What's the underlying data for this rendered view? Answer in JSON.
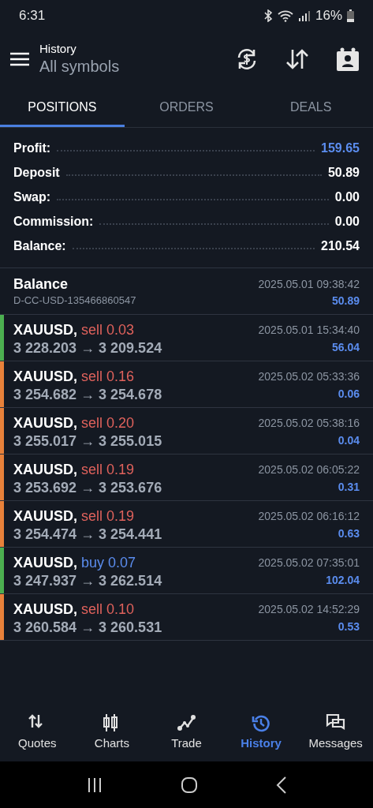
{
  "status_bar": {
    "time": "6:31",
    "battery": "16%"
  },
  "header": {
    "title": "History",
    "subtitle": "All symbols"
  },
  "tabs": [
    {
      "label": "POSITIONS",
      "selected": true
    },
    {
      "label": "ORDERS",
      "selected": false
    },
    {
      "label": "DEALS",
      "selected": false
    }
  ],
  "summary": [
    {
      "label": "Profit:",
      "value": "159.65",
      "highlight": true
    },
    {
      "label": "Deposit",
      "value": "50.89",
      "highlight": false
    },
    {
      "label": "Swap:",
      "value": "0.00",
      "highlight": false
    },
    {
      "label": "Commission:",
      "value": "0.00",
      "highlight": false
    },
    {
      "label": "Balance:",
      "value": "210.54",
      "highlight": false
    }
  ],
  "balance_entry": {
    "title": "Balance",
    "account": "D-CC-USD-135466860547",
    "time": "2025.05.01 09:38:42",
    "amount": "50.89"
  },
  "positions": [
    {
      "symbol": "XAUUSD,",
      "kind": "sell",
      "order": "sell 0.03",
      "prices": "3 228.203 → 3 209.524",
      "time": "2025.05.01 15:34:40",
      "profit": "56.04",
      "color": "#4caf50"
    },
    {
      "symbol": "XAUUSD,",
      "kind": "sell",
      "order": "sell 0.16",
      "prices": "3 254.682 → 3 254.678",
      "time": "2025.05.02 05:33:36",
      "profit": "0.06",
      "color": "#e8813a"
    },
    {
      "symbol": "XAUUSD,",
      "kind": "sell",
      "order": "sell 0.20",
      "prices": "3 255.017 → 3 255.015",
      "time": "2025.05.02 05:38:16",
      "profit": "0.04",
      "color": "#e8813a"
    },
    {
      "symbol": "XAUUSD,",
      "kind": "sell",
      "order": "sell 0.19",
      "prices": "3 253.692 → 3 253.676",
      "time": "2025.05.02 06:05:22",
      "profit": "0.31",
      "color": "#e8813a"
    },
    {
      "symbol": "XAUUSD,",
      "kind": "sell",
      "order": "sell 0.19",
      "prices": "3 254.474 → 3 254.441",
      "time": "2025.05.02 06:16:12",
      "profit": "0.63",
      "color": "#e8813a"
    },
    {
      "symbol": "XAUUSD,",
      "kind": "buy",
      "order": "buy 0.07",
      "prices": "3 247.937 → 3 262.514",
      "time": "2025.05.02 07:35:01",
      "profit": "102.04",
      "color": "#4caf50"
    },
    {
      "symbol": "XAUUSD,",
      "kind": "sell",
      "order": "sell 0.10",
      "prices": "3 260.584 → 3 260.531",
      "time": "2025.05.02 14:52:29",
      "profit": "0.53",
      "color": "#e8813a"
    }
  ],
  "bottom_nav": [
    {
      "label": "Quotes",
      "kind": "quotes",
      "selected": false
    },
    {
      "label": "Charts",
      "kind": "charts",
      "selected": false
    },
    {
      "label": "Trade",
      "kind": "trade",
      "selected": false
    },
    {
      "label": "History",
      "kind": "history",
      "selected": true
    },
    {
      "label": "Messages",
      "kind": "messages",
      "selected": false
    }
  ]
}
